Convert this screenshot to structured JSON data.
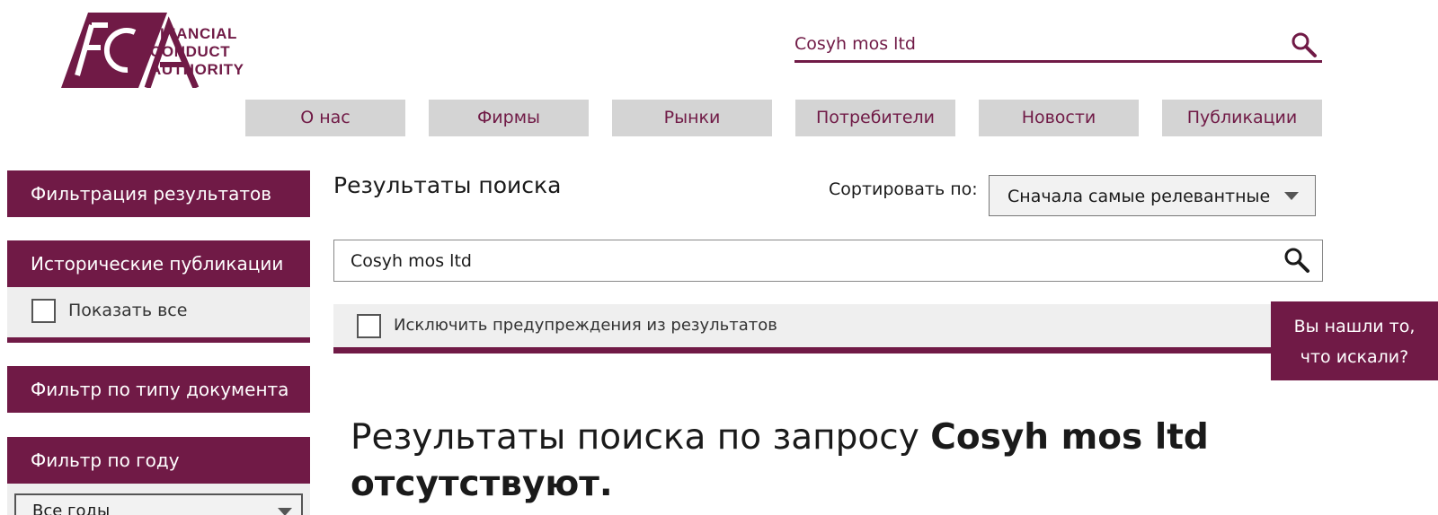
{
  "header": {
    "logo_letters": "FCA",
    "logo_lines": [
      "FINANCIAL",
      "CONDUCT",
      "AUTHORITY"
    ],
    "search_value": "Cosyh mos ltd",
    "search_icon": "search-icon"
  },
  "nav": {
    "items": [
      {
        "label": "О нас"
      },
      {
        "label": "Фирмы"
      },
      {
        "label": "Рынки"
      },
      {
        "label": "Потребители"
      },
      {
        "label": "Новости"
      },
      {
        "label": "Публикации"
      }
    ]
  },
  "sidebar": {
    "filter_results": "Фильтрация результатов",
    "historical": "Исторические публикации",
    "show_all": "Показать все",
    "doc_type": "Фильтр по типу документа",
    "by_year": "Фильтр по году",
    "year_select": "Все годы"
  },
  "main": {
    "title": "Результаты поиска",
    "sort_label": "Сортировать по:",
    "sort_value": "Сначала самые релевантные",
    "search_value": "Cosyh mos ltd",
    "exclude_warnings": "Исключить предупреждения из результатов",
    "no_results_prefix": "Результаты поиска по запросу",
    "no_results_query": "Cosyh mos ltd",
    "no_results_suffix": "отсутствуют."
  },
  "feedback": {
    "line1": "Вы нашли то,",
    "line2": "что искали?"
  },
  "colors": {
    "brand": "#701a46",
    "nav_bg": "#d4d4d4",
    "panel_bg": "#eeeeee"
  }
}
